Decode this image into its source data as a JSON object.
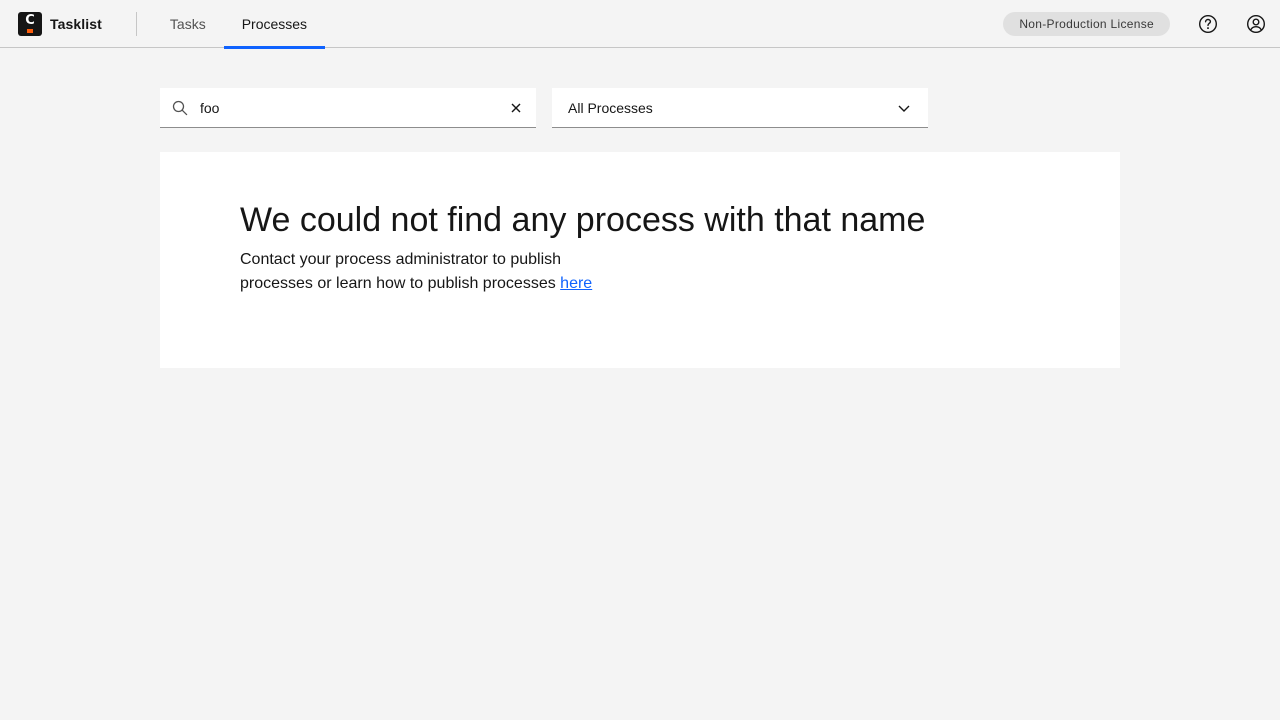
{
  "header": {
    "app_name": "Tasklist",
    "nav": [
      {
        "label": "Tasks",
        "active": false
      },
      {
        "label": "Processes",
        "active": true
      }
    ],
    "license_tag": "Non-Production License",
    "icons": {
      "help": "help-icon",
      "user": "user-avatar-icon"
    }
  },
  "filters": {
    "search": {
      "value": "foo",
      "placeholder": "Search processes"
    },
    "process_select": {
      "selected": "All Processes"
    }
  },
  "empty_state": {
    "title": "We could not find any process with that name",
    "description": "Contact your process administrator to publish processes or learn how to publish processes",
    "link_label": "here"
  },
  "colors": {
    "accent": "#0f62fe",
    "brand_mark": "#fc5d0d",
    "background": "#f4f4f4"
  }
}
